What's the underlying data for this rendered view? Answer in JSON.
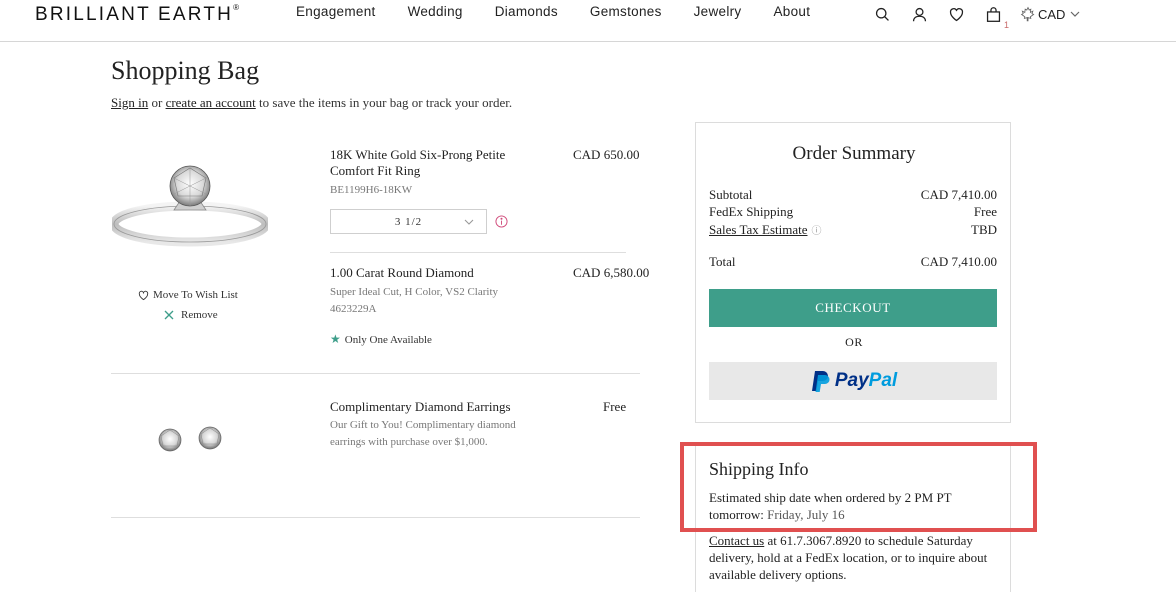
{
  "header": {
    "logo": "BRILLIANT EARTH",
    "logo_mark": "®",
    "nav": [
      "Engagement",
      "Wedding",
      "Diamonds",
      "Gemstones",
      "Jewelry",
      "About"
    ],
    "bag_count": "1",
    "currency": "CAD"
  },
  "page": {
    "title": "Shopping Bag",
    "sign_in": "Sign in",
    "or": " or ",
    "create_account": "create an account",
    "signin_suffix": " to save the items in your bag or track your order."
  },
  "items": [
    {
      "title": "18K White Gold Six-Prong Petite Comfort Fit Ring",
      "sku": "BE1199H6-18KW",
      "price": "CAD 650.00",
      "size": "3 1/2"
    },
    {
      "title": "1.00 Carat Round Diamond",
      "desc": "Super Ideal Cut, H Color, VS2 Clarity",
      "sku": "4623229A",
      "price": "CAD 6,580.00",
      "availability": "Only One Available"
    },
    {
      "title": "Complimentary Diamond Earrings",
      "desc": "Our Gift to You! Complimentary diamond earrings with purchase over $1,000.",
      "price": "Free"
    }
  ],
  "item_actions": {
    "wish": "Move To Wish List",
    "remove": "Remove"
  },
  "summary": {
    "title": "Order Summary",
    "subtotal_label": "Subtotal",
    "subtotal_value": "CAD 7,410.00",
    "shipping_label": "FedEx Shipping",
    "shipping_value": "Free",
    "tax_label": "Sales Tax Estimate",
    "tax_value": "TBD",
    "total_label": "Total",
    "total_value": "CAD 7,410.00",
    "checkout": "CHECKOUT",
    "or": "OR",
    "paypal_pay": "Pay",
    "paypal_pal": "Pal"
  },
  "shipping": {
    "title": "Shipping Info",
    "text": "Estimated ship date when ordered by 2 PM PT tomorrow: ",
    "date": "Friday, July 16",
    "contact_link": "Contact us",
    "contact_text": " at 61.7.3067.8920 to schedule Saturday delivery, hold at a FedEx location, or to inquire about available delivery options."
  },
  "colors": {
    "accent": "#3e9e8a",
    "highlight": "#e05050",
    "paypal_dark": "#003087",
    "paypal_light": "#009cde"
  }
}
